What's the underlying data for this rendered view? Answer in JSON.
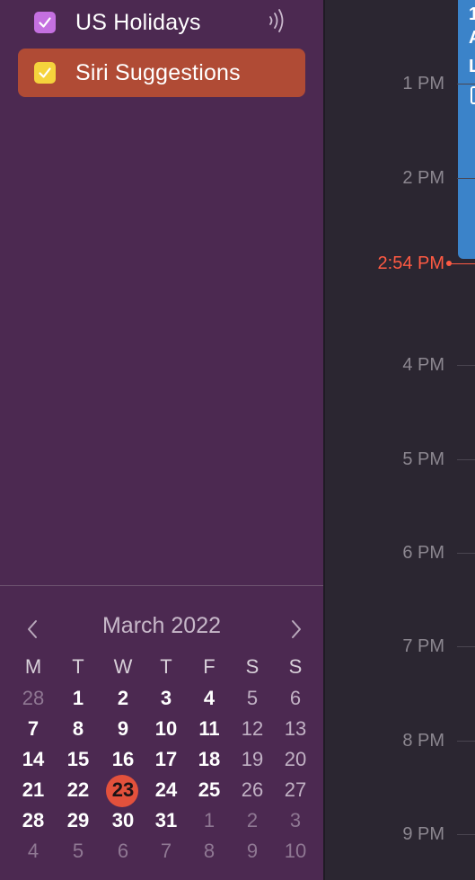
{
  "calendars": [
    {
      "label": "US Holidays",
      "checked": true,
      "color": "#c470e0",
      "subscribed_icon": "broadcast-icon",
      "selected": false
    },
    {
      "label": "Siri Suggestions",
      "checked": true,
      "color": "#f5d33c",
      "selected": true
    }
  ],
  "mini_calendar": {
    "month_title": "March 2022",
    "weekdays": [
      "M",
      "T",
      "W",
      "T",
      "F",
      "S",
      "S"
    ],
    "weeks": [
      [
        "28",
        "1",
        "2",
        "3",
        "4",
        "5",
        "6"
      ],
      [
        "7",
        "8",
        "9",
        "10",
        "11",
        "12",
        "13"
      ],
      [
        "14",
        "15",
        "16",
        "17",
        "18",
        "19",
        "20"
      ],
      [
        "21",
        "22",
        "23",
        "24",
        "25",
        "26",
        "27"
      ],
      [
        "28",
        "29",
        "30",
        "31",
        "1",
        "2",
        "3"
      ],
      [
        "4",
        "5",
        "6",
        "7",
        "8",
        "9",
        "10"
      ]
    ],
    "today": "23"
  },
  "timeline": {
    "hours": [
      "1 PM",
      "2 PM",
      "4 PM",
      "5 PM",
      "6 PM",
      "7 PM",
      "8 PM",
      "9 PM"
    ],
    "current_time": "2:54 PM",
    "now_color": "#ff5a43"
  },
  "event": {
    "text_lines": [
      "1",
      "A",
      "L"
    ],
    "color": "#3b83c9"
  }
}
